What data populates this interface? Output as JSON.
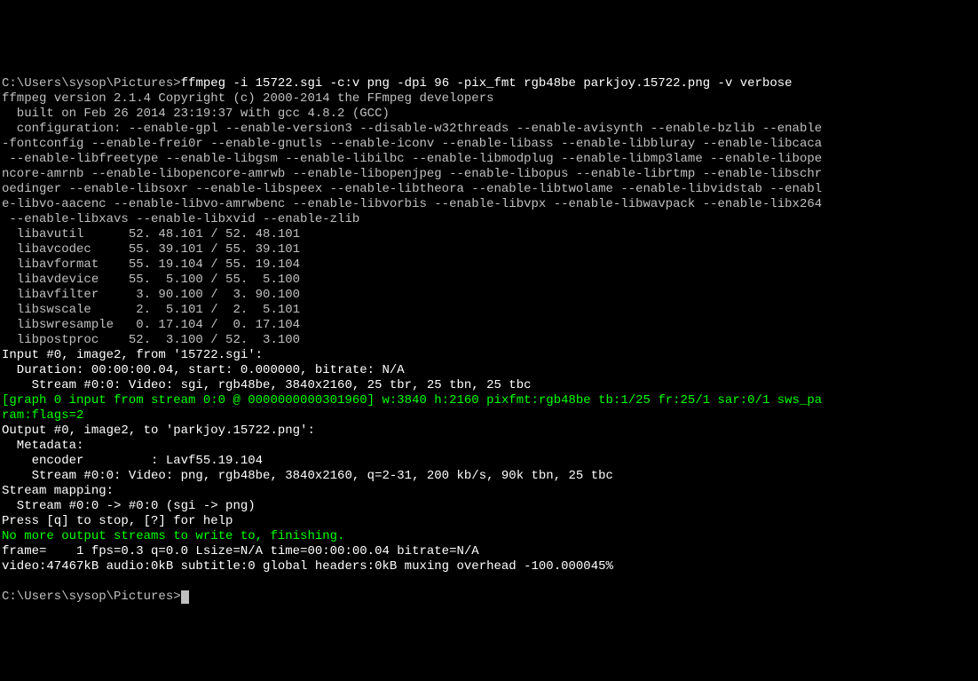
{
  "prompt1": "C:\\Users\\sysop\\Pictures>",
  "command": "ffmpeg -i 15722.sgi -c:v png -dpi 96 -pix_fmt rgb48be parkjoy.15722.png -v verbose",
  "banner": "ffmpeg version 2.1.4 Copyright (c) 2000-2014 the FFmpeg developers",
  "built": "  built on Feb 26 2014 23:19:37 with gcc 4.8.2 (GCC)",
  "config": "  configuration: --enable-gpl --enable-version3 --disable-w32threads --enable-avisynth --enable-bzlib --enable-fontconfig --enable-frei0r --enable-gnutls --enable-iconv --enable-libass --enable-libbluray --enable-libcaca --enable-libfreetype --enable-libgsm --enable-libilbc --enable-libmodplug --enable-libmp3lame --enable-libopencore-amrnb --enable-libopencore-amrwb --enable-libopenjpeg --enable-libopus --enable-librtmp --enable-libschroedinger --enable-libsoxr --enable-libspeex --enable-libtheora --enable-libtwolame --enable-libvidstab --enable-libvo-aacenc --enable-libvo-amrwbenc --enable-libvorbis --enable-libvpx --enable-libwavpack --enable-libx264 --enable-libxavs --enable-libxvid --enable-zlib",
  "libs": {
    "libavutil": "  libavutil      52. 48.101 / 52. 48.101",
    "libavcodec": "  libavcodec     55. 39.101 / 55. 39.101",
    "libavformat": "  libavformat    55. 19.104 / 55. 19.104",
    "libavdevice": "  libavdevice    55.  5.100 / 55.  5.100",
    "libavfilter": "  libavfilter     3. 90.100 /  3. 90.100",
    "libswscale": "  libswscale      2.  5.101 /  2.  5.101",
    "libswresample": "  libswresample   0. 17.104 /  0. 17.104",
    "libpostproc": "  libpostproc    52.  3.100 / 52.  3.100"
  },
  "input_header": "Input #0, image2, from '15722.sgi':",
  "input_duration": "  Duration: 00:00:00.04, start: 0.000000, bitrate: N/A",
  "input_stream": "    Stream #0:0: Video: sgi, rgb48be, 3840x2160, 25 tbr, 25 tbn, 25 tbc",
  "graph": "[graph 0 input from stream 0:0 @ 0000000000301960] w:3840 h:2160 pixfmt:rgb48be tb:1/25 fr:25/1 sar:0/1 sws_param:flags=2",
  "output_header": "Output #0, image2, to 'parkjoy.15722.png':",
  "metadata": "  Metadata:",
  "encoder": "    encoder         : Lavf55.19.104",
  "output_stream": "    Stream #0:0: Video: png, rgb48be, 3840x2160, q=2-31, 200 kb/s, 90k tbn, 25 tbc",
  "stream_mapping": "Stream mapping:",
  "mapping_line": "  Stream #0:0 -> #0:0 (sgi -> png)",
  "press": "Press [q] to stop, [?] for help",
  "finishing": "No more output streams to write to, finishing.",
  "frame": "frame=    1 fps=0.3 q=0.0 Lsize=N/A time=00:00:00.04 bitrate=N/A",
  "video_summary": "video:47467kB audio:0kB subtitle:0 global headers:0kB muxing overhead -100.000045%",
  "blank": "",
  "prompt2": "C:\\Users\\sysop\\Pictures>"
}
